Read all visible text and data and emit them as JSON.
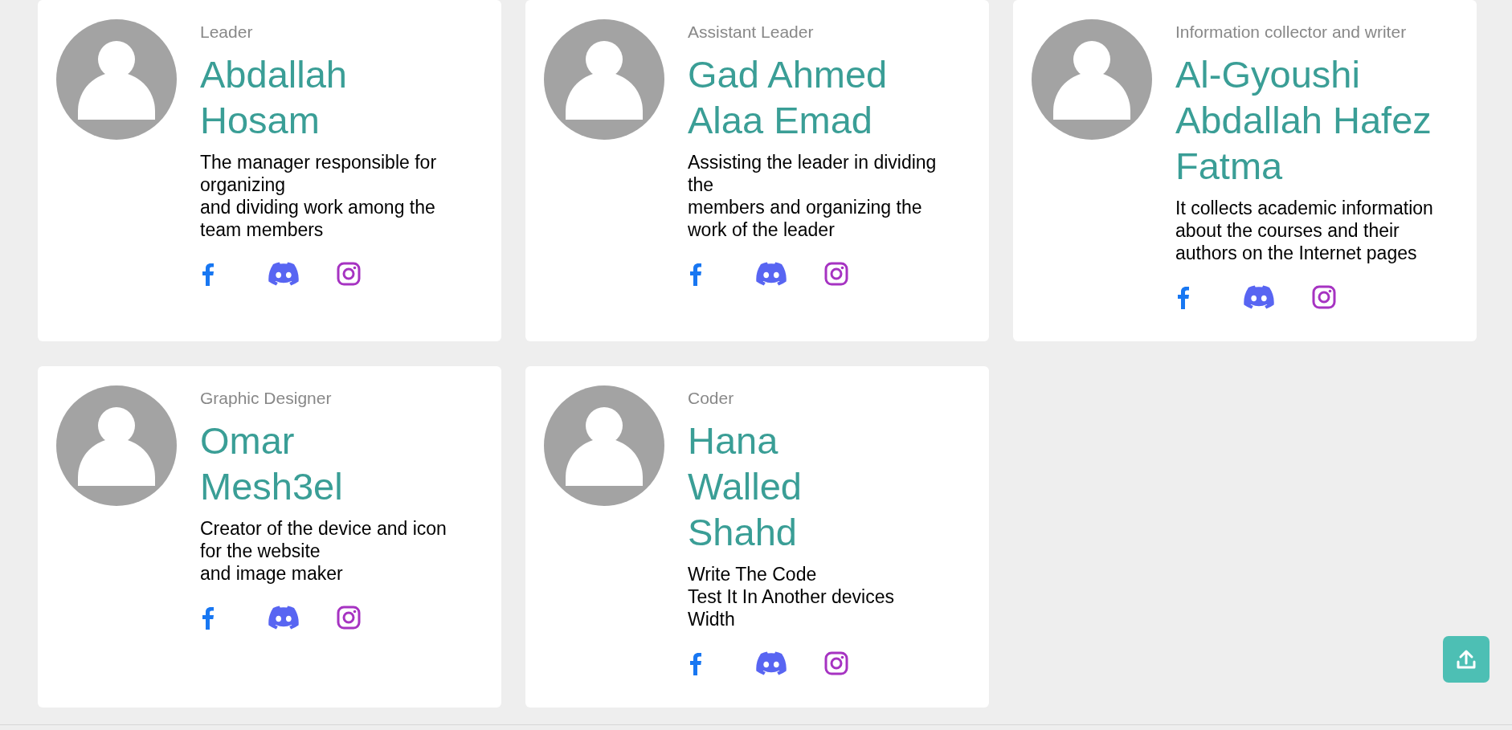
{
  "members": [
    {
      "role": "Leader",
      "names": [
        "Abdallah",
        "Hosam"
      ],
      "description": "The manager responsible for organizing\nand dividing work among the team members",
      "socials": [
        {
          "kind": "facebook"
        },
        {
          "kind": "discord"
        },
        {
          "kind": "instagram"
        }
      ]
    },
    {
      "role": "Assistant Leader",
      "names": [
        "Gad Ahmed",
        "Alaa Emad"
      ],
      "description": "Assisting the leader in dividing the\nmembers and organizing the work of the leader",
      "socials": [
        {
          "kind": "facebook"
        },
        {
          "kind": "discord"
        },
        {
          "kind": "instagram"
        }
      ]
    },
    {
      "role": "Information collector and writer",
      "names": [
        "Al-Gyoushi",
        "Abdallah Hafez",
        "Fatma"
      ],
      "description": "It collects academic information\nabout the courses and their authors on the Internet pages",
      "socials": [
        {
          "kind": "facebook"
        },
        {
          "kind": "discord"
        },
        {
          "kind": "instagram"
        }
      ]
    },
    {
      "role": "Graphic Designer",
      "names": [
        "Omar",
        "Mesh3el"
      ],
      "description": "Creator of the device and icon for the website\nand image maker",
      "socials": [
        {
          "kind": "facebook"
        },
        {
          "kind": "discord"
        },
        {
          "kind": "instagram"
        }
      ]
    },
    {
      "role": "Coder",
      "names": [
        "Hana",
        "Walled",
        "Shahd"
      ],
      "description": "Write The Code\nTest It In Another devices\nWidth",
      "socials": [
        {
          "kind": "facebook"
        },
        {
          "kind": "discord"
        },
        {
          "kind": "instagram"
        }
      ]
    }
  ]
}
